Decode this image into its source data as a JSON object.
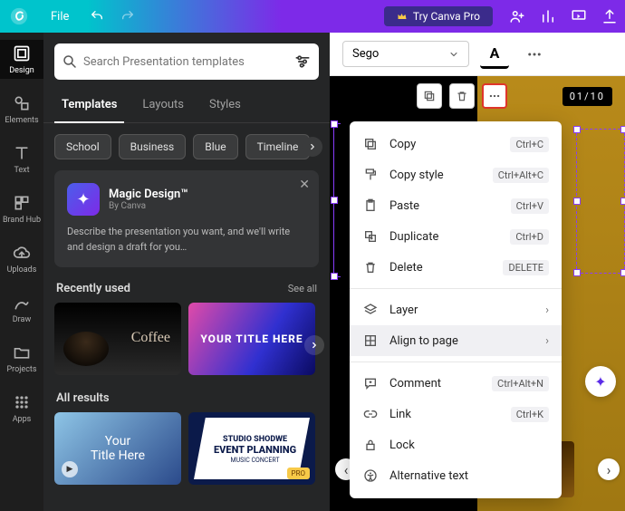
{
  "topbar": {
    "file": "File",
    "try_pro": "Try Canva Pro"
  },
  "rail": [
    {
      "label": "Design"
    },
    {
      "label": "Elements"
    },
    {
      "label": "Text"
    },
    {
      "label": "Brand Hub"
    },
    {
      "label": "Uploads"
    },
    {
      "label": "Draw"
    },
    {
      "label": "Projects"
    },
    {
      "label": "Apps"
    }
  ],
  "search": {
    "placeholder": "Search Presentation templates"
  },
  "tabs": [
    {
      "label": "Templates"
    },
    {
      "label": "Layouts"
    },
    {
      "label": "Styles"
    }
  ],
  "chips": [
    {
      "label": "School"
    },
    {
      "label": "Business"
    },
    {
      "label": "Blue"
    },
    {
      "label": "Timeline"
    }
  ],
  "magic": {
    "title": "Magic Design™",
    "by": "By Canva",
    "desc": "Describe the presentation you want, and we'll write and design a draft for you…"
  },
  "recent": {
    "title": "Recently used",
    "see_all": "See all",
    "coffee": "Coffee",
    "your_title": "YOUR TITLE HERE"
  },
  "all": {
    "title": "All results",
    "line1": "Your",
    "line2": "Title Here",
    "event1": "STUDIO SHODWE",
    "event2": "EVENT PLANNING",
    "event3": "MUSIC CONCERT",
    "pro": "PRO"
  },
  "toolbar": {
    "font": "Sego",
    "text_color": "A"
  },
  "page": {
    "counter": "01/10"
  },
  "context_menu": {
    "copy": {
      "label": "Copy",
      "shortcut": "Ctrl+C"
    },
    "copy_style": {
      "label": "Copy style",
      "shortcut": "Ctrl+Alt+C"
    },
    "paste": {
      "label": "Paste",
      "shortcut": "Ctrl+V"
    },
    "duplicate": {
      "label": "Duplicate",
      "shortcut": "Ctrl+D"
    },
    "delete": {
      "label": "Delete",
      "shortcut": "DELETE"
    },
    "layer": {
      "label": "Layer"
    },
    "align": {
      "label": "Align to page"
    },
    "comment": {
      "label": "Comment",
      "shortcut": "Ctrl+Alt+N"
    },
    "link": {
      "label": "Link",
      "shortcut": "Ctrl+K"
    },
    "lock": {
      "label": "Lock"
    },
    "alt_text": {
      "label": "Alternative text"
    }
  }
}
